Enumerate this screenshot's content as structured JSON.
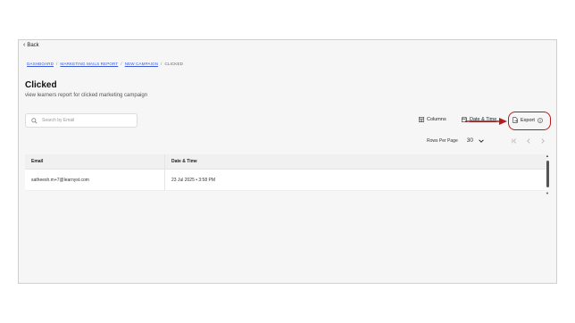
{
  "back_label": "Back",
  "breadcrumbs": [
    {
      "label": "DASHBOARD"
    },
    {
      "label": "MARKETING MAILS REPORT"
    },
    {
      "label": "NEW CAMPAIGN"
    },
    {
      "label": "CLICKED"
    }
  ],
  "breadcrumb_separator": "/",
  "page": {
    "title": "Clicked",
    "subtitle": "view learners report for clicked marketing campaign"
  },
  "search": {
    "placeholder": "Search by Email",
    "value": ""
  },
  "toolbar": {
    "columns_label": "Columns",
    "datetime_label": "Date & Time",
    "export_label": "Export"
  },
  "pagination": {
    "rows_per_page_label": "Rows Per Page",
    "rows_per_page_value": "30"
  },
  "table": {
    "headers": [
      "Email",
      "Date & Time"
    ],
    "rows": [
      [
        "satheesh.m+7@learnyst.com",
        "23 Jul 2025 • 3:58 PM"
      ]
    ]
  },
  "colors": {
    "accent_link": "#3a5bd9",
    "annotation_red": "#b31d1d"
  }
}
